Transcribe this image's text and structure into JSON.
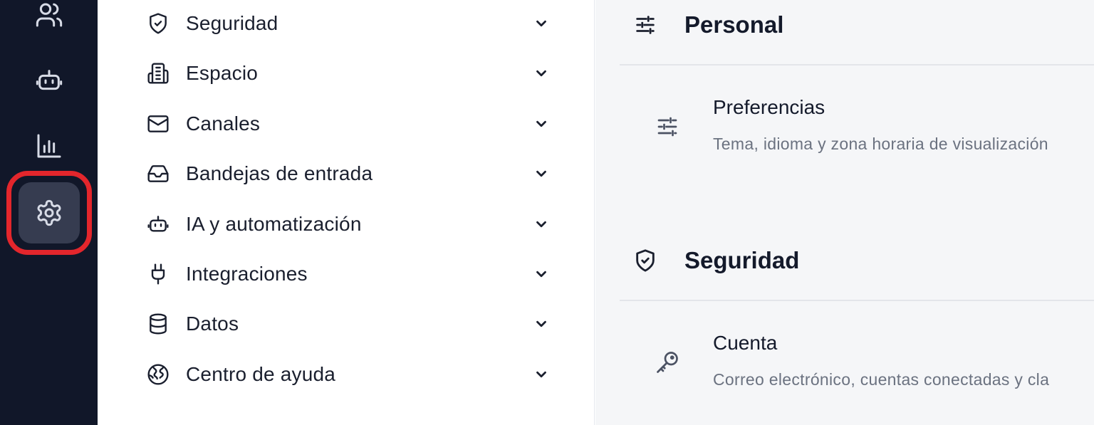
{
  "rail": {
    "items": [
      {
        "icon": "users-icon"
      },
      {
        "icon": "robot-icon"
      },
      {
        "icon": "bar-chart-icon"
      },
      {
        "icon": "gear-icon",
        "active": true
      }
    ],
    "highlight_color": "#e3262c"
  },
  "nav": {
    "items": [
      {
        "label": "Seguridad",
        "icon": "shield-check-icon"
      },
      {
        "label": "Espacio",
        "icon": "building-icon"
      },
      {
        "label": "Canales",
        "icon": "mail-icon"
      },
      {
        "label": "Bandejas de entrada",
        "icon": "inbox-icon"
      },
      {
        "label": "IA y automatización",
        "icon": "robot-icon"
      },
      {
        "label": "Integraciones",
        "icon": "plug-icon"
      },
      {
        "label": "Datos",
        "icon": "database-icon"
      },
      {
        "label": "Centro de ayuda",
        "icon": "globe-icon"
      }
    ]
  },
  "main": {
    "sections": [
      {
        "title": "Personal",
        "icon": "sliders-icon",
        "cards": [
          {
            "title": "Preferencias",
            "description": "Tema, idioma y zona horaria de visualización",
            "icon": "sliders-icon"
          }
        ]
      },
      {
        "title": "Seguridad",
        "icon": "shield-check-icon",
        "cards": [
          {
            "title": "Cuenta",
            "description": "Correo electrónico, cuentas conectadas y cla",
            "icon": "key-icon"
          }
        ]
      }
    ]
  },
  "colors": {
    "rail_bg": "#111729",
    "rail_active": "#363c50",
    "main_bg": "#f5f6f8",
    "text_primary": "#141a2b",
    "text_secondary": "#6b7280"
  }
}
